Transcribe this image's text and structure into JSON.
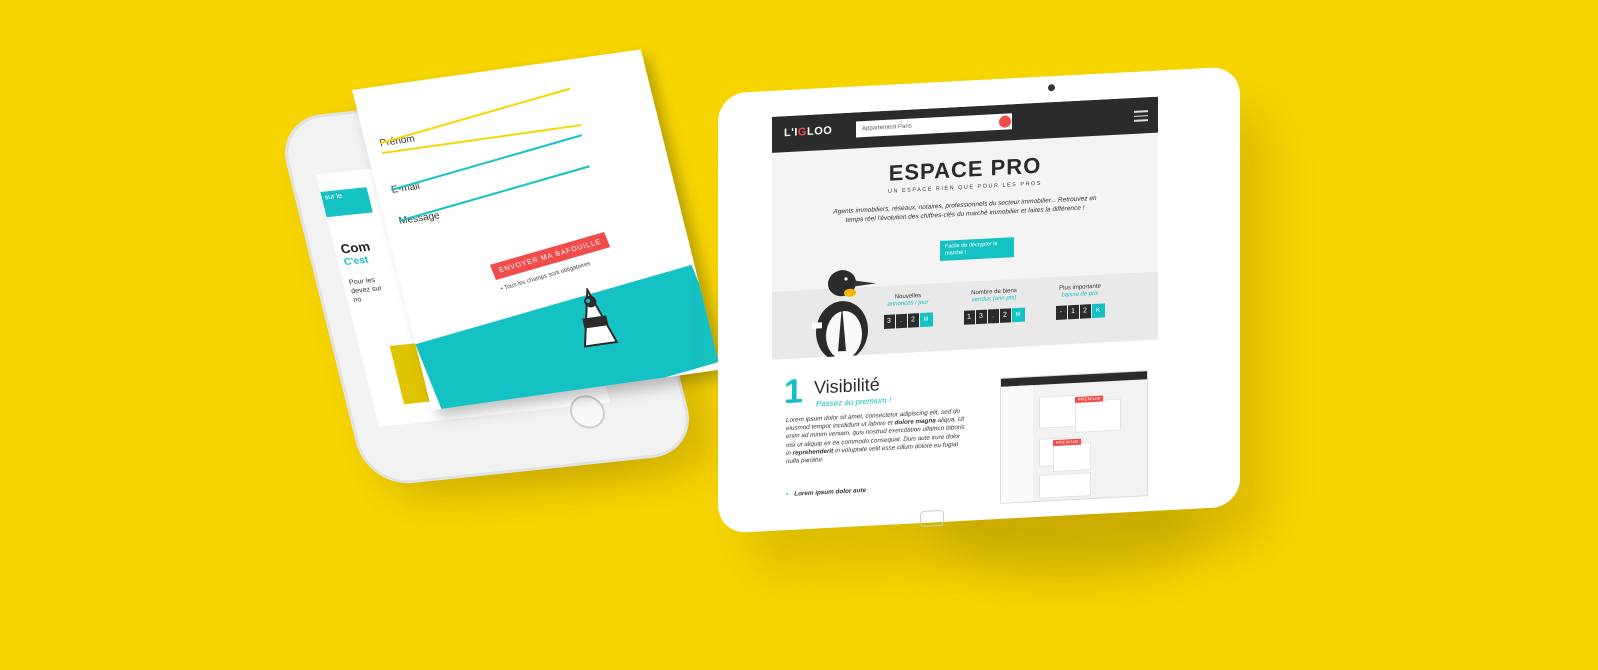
{
  "colors": {
    "background": "#f7d600",
    "teal": "#15c2c3",
    "red": "#f04c4c",
    "dark": "#2b2b2b"
  },
  "phone": {
    "tab_label": "sur le",
    "heading_fragment": "Com",
    "subheading_fragment": "C'est",
    "body_fragment": "Pour les devez sur no",
    "form": {
      "firstname_label": "Prénom",
      "email_label": "E-mail",
      "message_label": "Message",
      "submit_label": "ENVOYER MA BAFOUILLE",
      "required_note": "• Tous les champs sont obligatoires"
    }
  },
  "tablet": {
    "logo": {
      "prefix": "L'I",
      "accent": "G",
      "suffix": "LOO"
    },
    "search_value": "Appartement Paris",
    "menu_icon": "hamburger-icon",
    "title": "ESPACE PRO",
    "subtitle": "UN ESPACE RIEN QUE POUR LES PROS",
    "intro": "Agents immobiliers, réseaux, notaires, professionnels du secteur immobilier... Retrouvez en temps réel l'évolution des chiffres-clés du marché immobilier et faites la différence !",
    "bubble": "Facile de décrypter le marché !",
    "stats": [
      {
        "label": "Nouvelles",
        "highlight": "annonces / jour",
        "digits": [
          "3",
          ".",
          "2"
        ],
        "unit": "M"
      },
      {
        "label": "Nombre de biens",
        "highlight": "vendus (ann pts)",
        "digits": [
          "1",
          "3",
          ".",
          "2"
        ],
        "unit": "M"
      },
      {
        "label": "Plus importante",
        "highlight": "baisse de prix",
        "digits": [
          "-",
          "1",
          "2"
        ],
        "unit": "K"
      }
    ],
    "visibility": {
      "number": "1",
      "title": "Visibilité",
      "subtitle": "Passez au premium !",
      "body_1": "Lorem ipsum dolor sit amet, consectetur adipiscing elit, sed do eiusmod tempor incididunt ut labore et ",
      "body_bold_1": "dolore magna",
      "body_2": " aliqua. Ut enim ad minim veniam, quis nostrud exercitation ullamco laboris nisi ut aliquip ex ea commodo consequat. Duis aute irure dolor in ",
      "body_bold_2": "reprehenderit",
      "body_3": " in voluptate velit esse cillum dolore eu fugiat nulla pariatur.",
      "bullet": "Lorem ipsum dolor aute",
      "mock_logo": "L'IGLOO",
      "mock_premium_1": "PREMIUM",
      "mock_premium_2": "PREMIUM"
    }
  }
}
